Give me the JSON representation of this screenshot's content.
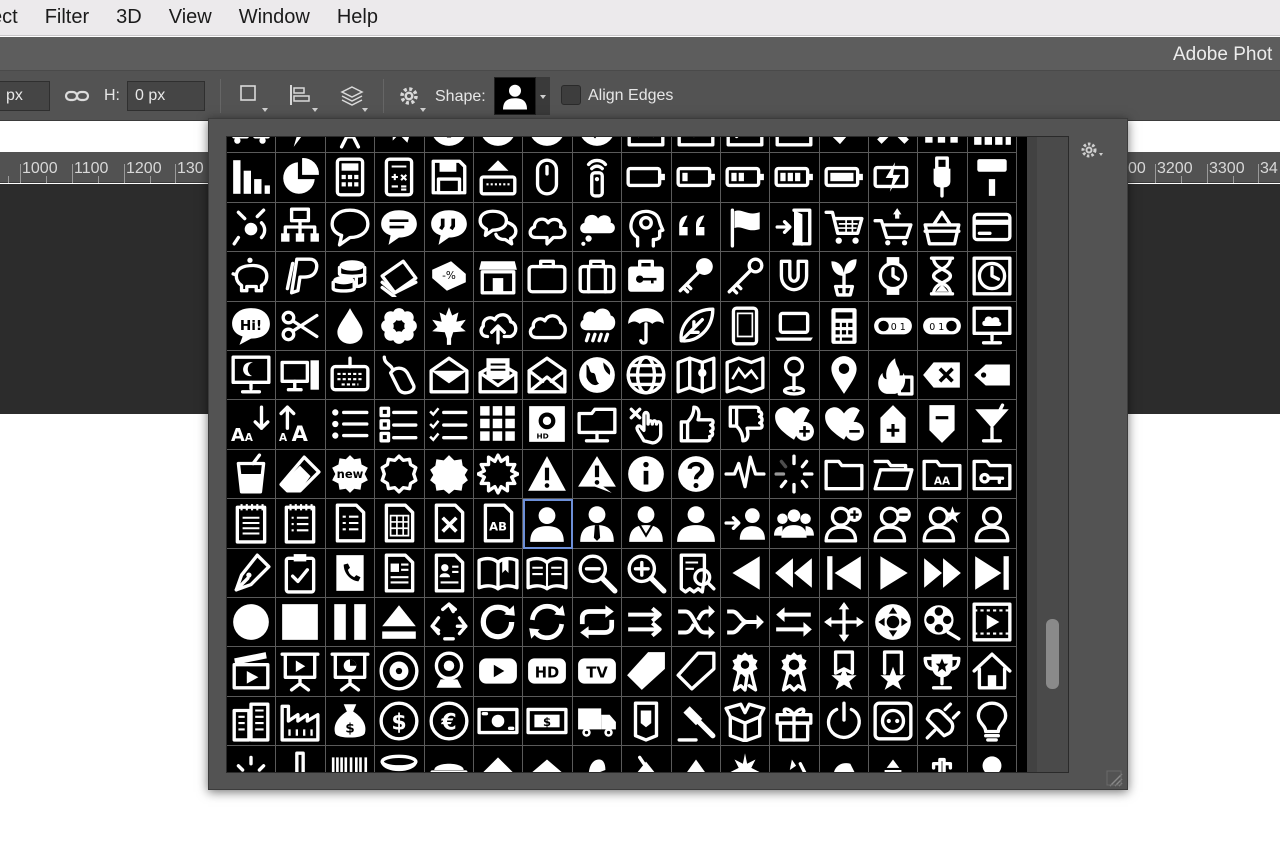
{
  "menubar": {
    "items": [
      "ect",
      "Filter",
      "3D",
      "View",
      "Window",
      "Help"
    ]
  },
  "titlebar": {
    "title": "Adobe Phot"
  },
  "options": {
    "w_value": "px",
    "h_label": "H:",
    "h_value": "0 px",
    "shape_label": "Shape:",
    "align_label": "Align Edges",
    "shape_icon": "person-bust-icon"
  },
  "ruler": {
    "left_numbers": [
      "1000",
      "1100",
      "1200",
      "130"
    ],
    "right_numbers": [
      "00",
      "3200",
      "3300",
      "34"
    ]
  },
  "picker": {
    "selected_shape": "person-bust",
    "rows": [
      [
        "car-pair",
        "lightning-bolt",
        "rocket",
        "airplane",
        "plus-circle",
        "minus-circle",
        "x-circle",
        "check-circle",
        "x-box",
        "check-box",
        "send-box",
        "download-box",
        "checkmark",
        "x-mark",
        "bars-three",
        "signal-bars"
      ],
      [
        "bar-chart-down",
        "pie-chart",
        "calculator",
        "calculator-keys",
        "floppy-disk",
        "keyboard-eject",
        "mouse",
        "remote-control",
        "battery-empty",
        "battery-low",
        "battery-half",
        "battery-high",
        "battery-full",
        "battery-charging",
        "usb-plug",
        "paint-roller"
      ],
      [
        "satellite",
        "network-tree",
        "speech-bubble",
        "speech-bubble-lines",
        "quote-bubble",
        "chat-bubbles",
        "cloud-bubble",
        "thought-bubble",
        "head-brain",
        "quote-marks",
        "flag",
        "door-exit",
        "shopping-cart",
        "cart-add",
        "basket",
        "credit-card"
      ],
      [
        "piggy-bank",
        "paypal",
        "coins",
        "cash-stack",
        "discount-tag",
        "store-front",
        "briefcase",
        "suitcase",
        "key-case",
        "key",
        "skeleton-key",
        "magnet",
        "plant-sprout",
        "wristwatch",
        "hourglass",
        "clock"
      ],
      [
        "hi-bubble",
        "scissors",
        "water-drop",
        "flower",
        "maple-leaf",
        "cloud-upload",
        "cloud",
        "cloud-rain",
        "umbrella",
        "leaf",
        "tablet",
        "laptop",
        "calculator-small",
        "toggle-off",
        "toggle-on",
        "monitor-cloud"
      ],
      [
        "monitor-moon",
        "desktop-tower",
        "keyboard",
        "mouse-wired",
        "envelope-open",
        "envelope-letter",
        "envelope-open-alt",
        "globe-earth",
        "globe-grid",
        "map-pin-map",
        "map-route",
        "map-pin",
        "location-pin",
        "fire-building",
        "backspace",
        "price-tag"
      ],
      [
        "sort-alpha-down",
        "sort-alpha-up",
        "list-bullets",
        "list-check-empty",
        "list-checked",
        "grid-nine",
        "hd-video",
        "folder-chart",
        "hand-pointer",
        "thumbs-up",
        "thumbs-down",
        "heart-plus",
        "heart-minus",
        "document-plus",
        "document-minus",
        "cocktail"
      ],
      [
        "drink-glass",
        "eraser",
        "new-badge",
        "badge-outline",
        "badge-filled",
        "badge-spiky",
        "warning-triangle",
        "warning-speech",
        "info-circle",
        "question-circle",
        "pulse-line",
        "loading-spinner",
        "folder",
        "folder-open",
        "folder-text",
        "folder-key"
      ],
      [
        "notepad-lines",
        "notepad-list",
        "document-lines",
        "spreadsheet",
        "document-delete",
        "document-text",
        "person-bust",
        "person-tie",
        "person-suit",
        "person-group-bust",
        "person-add-arrow",
        "people-group",
        "person-add",
        "person-remove",
        "person-star",
        "person-outline"
      ],
      [
        "fountain-pen",
        "clipboard-check",
        "phone-book",
        "news-document",
        "id-card",
        "open-book",
        "book",
        "zoom-out",
        "zoom-in",
        "receipt-search",
        "play-reverse",
        "rewind",
        "skip-back",
        "play",
        "fast-forward",
        "skip-forward"
      ],
      [
        "record-circle",
        "stop-square",
        "pause",
        "eject",
        "recycle",
        "refresh",
        "sync",
        "repeat",
        "arrows-right",
        "shuffle",
        "merge-arrows",
        "swap-arrows",
        "move-arrows",
        "dpad",
        "film-reel",
        "film-play"
      ],
      [
        "clapperboard",
        "presentation-play",
        "presentation-chart",
        "disc",
        "webcam",
        "youtube",
        "hd-badge",
        "tv-badge",
        "tag-solid",
        "tag-outline",
        "award-ribbon",
        "award-ribbon-outline",
        "star-ribbon",
        "star-ribbon-outline",
        "trophy",
        "house"
      ],
      [
        "office-building",
        "factory",
        "money-bag",
        "dollar-circle",
        "euro-circle",
        "banknote",
        "banknote-dollar",
        "delivery-truck",
        "bookmark-shield",
        "gavel",
        "package-open",
        "gift",
        "power",
        "socket",
        "electric-plug",
        "light-bulb"
      ],
      [
        "sun-rise",
        "thermometer",
        "barcode",
        "dish",
        "cake",
        "diamond-up",
        "ship",
        "hat",
        "crown",
        "triangle-up",
        "star-burst",
        "moon-star",
        "horse",
        "chess",
        "cactus",
        "magnifier"
      ]
    ]
  }
}
